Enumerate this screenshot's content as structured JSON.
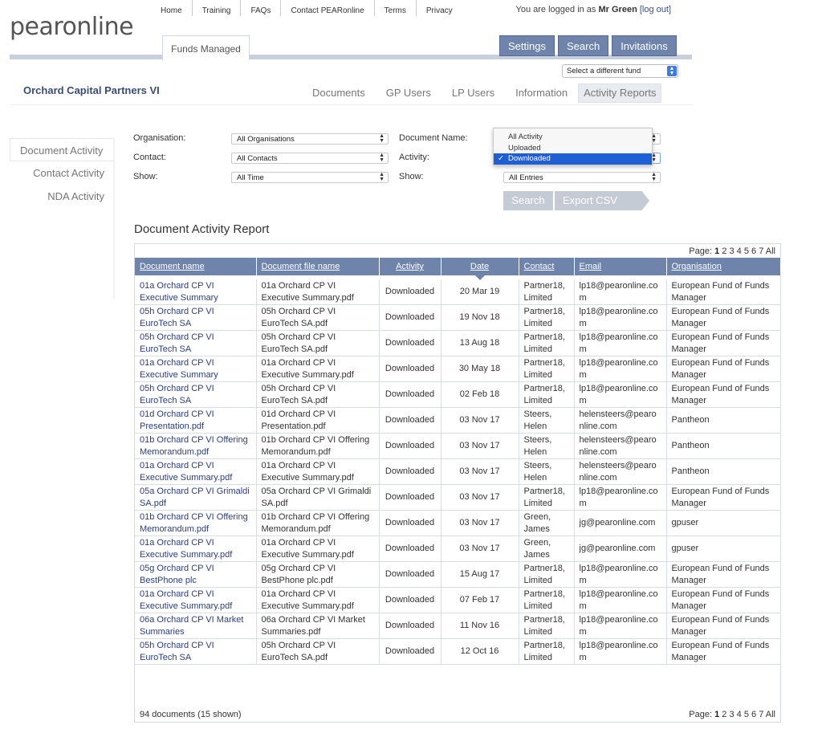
{
  "brand": {
    "logo_text": "pearonline"
  },
  "topnav": {
    "items": [
      "Home",
      "Training",
      "FAQs",
      "Contact PEARonline",
      "Terms",
      "Privacy"
    ]
  },
  "login": {
    "prefix": "You are logged in as",
    "user": "Mr Green",
    "logout": "[log out]"
  },
  "main_tab": {
    "label": "Funds Managed"
  },
  "top_buttons": [
    "Settings",
    "Search",
    "Invitations"
  ],
  "fund_select": {
    "value": "Select a different fund"
  },
  "fund": {
    "title": "Orchard Capital Partners VI"
  },
  "subtabs": [
    "Documents",
    "GP Users",
    "LP Users",
    "Information",
    "Activity Reports"
  ],
  "sidebar": {
    "items": [
      "Document Activity",
      "Contact Activity",
      "NDA Activity"
    ]
  },
  "filters": {
    "organisation": {
      "label": "Organisation:",
      "value": "All Organisations"
    },
    "contact": {
      "label": "Contact:",
      "value": "All Contacts"
    },
    "show_time": {
      "label": "Show:",
      "value": "All Time"
    },
    "document_name": {
      "label": "Document Name:"
    },
    "activity": {
      "label": "Activity:"
    },
    "show_entries": {
      "label": "Show:",
      "value": "All Entries"
    }
  },
  "activity_dropdown": {
    "options": [
      "All Activity",
      "Uploaded",
      "Downloaded"
    ],
    "selected": "Downloaded",
    "check": "✓"
  },
  "actions": {
    "search": "Search",
    "export": "Export CSV"
  },
  "report": {
    "title": "Document Activity Report",
    "pager_label": "Page:",
    "pages": [
      "1",
      "2",
      "3",
      "4",
      "5",
      "6",
      "7"
    ],
    "pager_all": "All",
    "summary": "94 documents (15 shown)",
    "columns": [
      "Document name",
      "Document file name",
      "Activity",
      "Date",
      "Contact",
      "Email",
      "Organisation"
    ],
    "rows": [
      [
        "01a Orchard CP VI Executive Summary",
        "01a Orchard CP VI Executive Summary.pdf",
        "Downloaded",
        "20 Mar 19",
        "Partner18, Limited",
        "lp18@pearonline.com",
        "European Fund of Funds Manager"
      ],
      [
        "05h Orchard CP VI EuroTech SA",
        "05h Orchard CP VI EuroTech SA.pdf",
        "Downloaded",
        "19 Nov 18",
        "Partner18, Limited",
        "lp18@pearonline.com",
        "European Fund of Funds Manager"
      ],
      [
        "05h Orchard CP VI EuroTech SA",
        "05h Orchard CP VI EuroTech SA.pdf",
        "Downloaded",
        "13 Aug 18",
        "Partner18, Limited",
        "lp18@pearonline.com",
        "European Fund of Funds Manager"
      ],
      [
        "01a Orchard CP VI Executive Summary",
        "01a Orchard CP VI Executive Summary.pdf",
        "Downloaded",
        "30 May 18",
        "Partner18, Limited",
        "lp18@pearonline.com",
        "European Fund of Funds Manager"
      ],
      [
        "05h Orchard CP VI EuroTech SA",
        "05h Orchard CP VI EuroTech SA.pdf",
        "Downloaded",
        "02 Feb 18",
        "Partner18, Limited",
        "lp18@pearonline.com",
        "European Fund of Funds Manager"
      ],
      [
        "01d Orchard CP VI Presentation.pdf",
        "01d Orchard CP VI Presentation.pdf",
        "Downloaded",
        "03 Nov 17",
        "Steers, Helen",
        "helensteers@pearonline.com",
        "Pantheon"
      ],
      [
        "01b Orchard CP VI Offering Memorandum.pdf",
        "01b Orchard CP VI Offering Memorandum.pdf",
        "Downloaded",
        "03 Nov 17",
        "Steers, Helen",
        "helensteers@pearonline.com",
        "Pantheon"
      ],
      [
        "01a Orchard CP VI Executive Summary.pdf",
        "01a Orchard CP VI Executive Summary.pdf",
        "Downloaded",
        "03 Nov 17",
        "Steers, Helen",
        "helensteers@pearonline.com",
        "Pantheon"
      ],
      [
        "05a Orchard CP VI Grimaldi SA.pdf",
        "05a Orchard CP VI Grimaldi SA.pdf",
        "Downloaded",
        "03 Nov 17",
        "Partner18, Limited",
        "lp18@pearonline.com",
        "European Fund of Funds Manager"
      ],
      [
        "01b Orchard CP VI Offering Memorandum.pdf",
        "01b Orchard CP VI Offering Memorandum.pdf",
        "Downloaded",
        "03 Nov 17",
        "Green, James",
        "jg@pearonline.com",
        "gpuser"
      ],
      [
        "01a Orchard CP VI Executive Summary.pdf",
        "01a Orchard CP VI Executive Summary.pdf",
        "Downloaded",
        "03 Nov 17",
        "Green, James",
        "jg@pearonline.com",
        "gpuser"
      ],
      [
        "05g Orchard CP VI BestPhone plc",
        "05g Orchard CP VI BestPhone plc.pdf",
        "Downloaded",
        "15 Aug 17",
        "Partner18, Limited",
        "lp18@pearonline.com",
        "European Fund of Funds Manager"
      ],
      [
        "01a Orchard CP VI Executive Summary.pdf",
        "01a Orchard CP VI Executive Summary.pdf",
        "Downloaded",
        "07 Feb 17",
        "Partner18, Limited",
        "lp18@pearonline.com",
        "European Fund of Funds Manager"
      ],
      [
        "06a Orchard CP VI Market Summaries",
        "06a Orchard CP VI Market Summaries.pdf",
        "Downloaded",
        "11 Nov 16",
        "Partner18, Limited",
        "lp18@pearonline.com",
        "European Fund of Funds Manager"
      ],
      [
        "05h Orchard CP VI EuroTech SA",
        "05h Orchard CP VI EuroTech SA.pdf",
        "Downloaded",
        "12 Oct 16",
        "Partner18, Limited",
        "lp18@pearonline.com",
        "European Fund of Funds Manager"
      ]
    ]
  }
}
